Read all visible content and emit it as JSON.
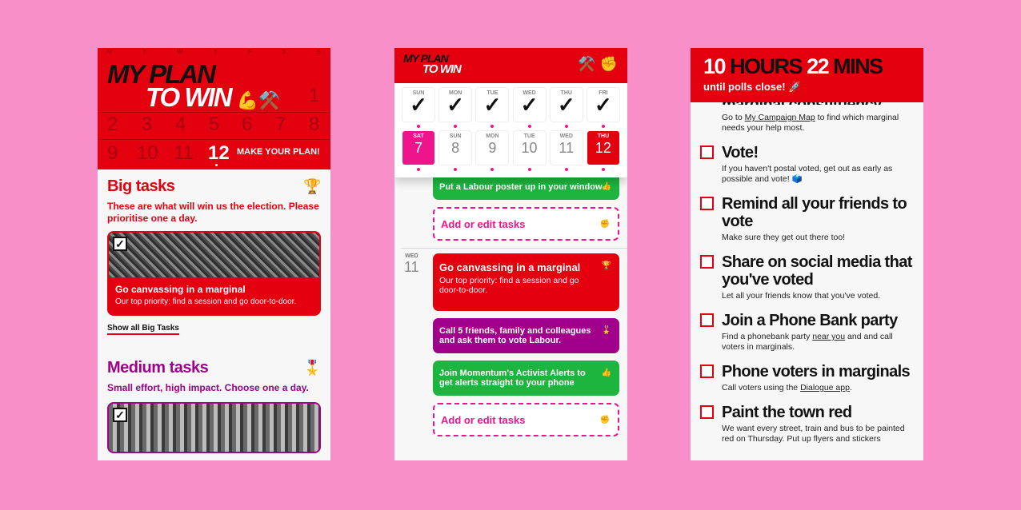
{
  "panel1": {
    "weekday_letters": [
      "M",
      "T",
      "W",
      "T",
      "F",
      "S",
      "S"
    ],
    "title_line1": "MY PLAN",
    "title_line2": "TO WIN",
    "title_emoji": "💪⚒️",
    "calendar": {
      "row1": [
        "1"
      ],
      "row2": [
        "2",
        "3",
        "4",
        "5",
        "6",
        "7",
        "8"
      ],
      "row3": [
        "9",
        "10",
        "11"
      ],
      "today": "12",
      "cta": "MAKE YOUR PLAN!"
    },
    "big": {
      "title": "Big tasks",
      "icon": "🏆",
      "subtitle": "These are what will win us the election. Please prioritise one a day.",
      "card_title": "Go canvassing in a marginal",
      "card_desc": "Our top priority: find a session and go door-to-door.",
      "check": "✓",
      "show_all": "Show all Big Tasks"
    },
    "medium": {
      "title": "Medium tasks",
      "icon": "🎖️",
      "subtitle": "Small effort, high impact. Choose one a day.",
      "check": "✓"
    }
  },
  "panel2": {
    "logo_line1": "MY PLAN",
    "logo_line2": "TO WIN",
    "icons": "⚒️ ✊",
    "top_row": [
      {
        "day": "SUN",
        "mark": "✓"
      },
      {
        "day": "MON",
        "mark": "✓"
      },
      {
        "day": "TUE",
        "mark": "✓"
      },
      {
        "day": "WED",
        "mark": "✓"
      },
      {
        "day": "THU",
        "mark": "✓"
      },
      {
        "day": "FRI",
        "mark": "✓"
      }
    ],
    "bottom_row": [
      {
        "day": "SAT",
        "num": "7"
      },
      {
        "day": "SUN",
        "num": "8"
      },
      {
        "day": "MON",
        "num": "9"
      },
      {
        "day": "TUE",
        "num": "10"
      },
      {
        "day": "WED",
        "num": "11"
      },
      {
        "day": "THU",
        "num": "12"
      }
    ],
    "poster_task": "Put a Labour poster up in your window",
    "poster_emoji": "👍",
    "add_edit_1": "Add or edit tasks",
    "add_emoji": "✊",
    "wed_label": "WED",
    "wed_num": "11",
    "task_canvass_title": "Go canvassing in a marginal",
    "task_canvass_desc": "Our top priority: find a session and go door-to-door.",
    "task_canvass_emoji": "🏆",
    "task_friends": "Call 5 friends, family and colleagues and ask them to vote Labour.",
    "task_friends_emoji": "🎖️",
    "task_alerts": "Join Momentum's Activist Alerts to get alerts straight to your phone",
    "task_alerts_emoji": "👍",
    "add_edit_2": "Add or edit tasks"
  },
  "panel3": {
    "countdown_hours": "10",
    "countdown_hours_label": "HOURS",
    "countdown_mins": "22",
    "countdown_mins_label": "MINS",
    "until": "until polls close! 🚀",
    "partial_title": "marginal constituency",
    "partial_desc_pre": "Go to ",
    "partial_desc_link": "My Campaign Map",
    "partial_desc_post": " to find which marginal needs your help most.",
    "items": [
      {
        "title": "Vote!",
        "desc": "If you haven't postal voted, get out as early as possible and vote! 🗳️"
      },
      {
        "title": "Remind all your friends to vote",
        "desc": "Make sure they get out there too!"
      },
      {
        "title": "Share on social media that you've voted",
        "desc": "Let all your friends know that you've voted."
      },
      {
        "title": "Join a Phone Bank party",
        "desc_pre": "Find a phonebank party ",
        "desc_link": "near you",
        "desc_post": " and  and call voters in marginals."
      },
      {
        "title": "Phone voters in marginals",
        "desc_pre": "Call voters using the ",
        "desc_link": "Dialogue app",
        "desc_post": "."
      },
      {
        "title": "Paint the town red",
        "desc": "We want every street, train and bus to be painted red on Thursday. Put up flyers and stickers"
      }
    ]
  }
}
